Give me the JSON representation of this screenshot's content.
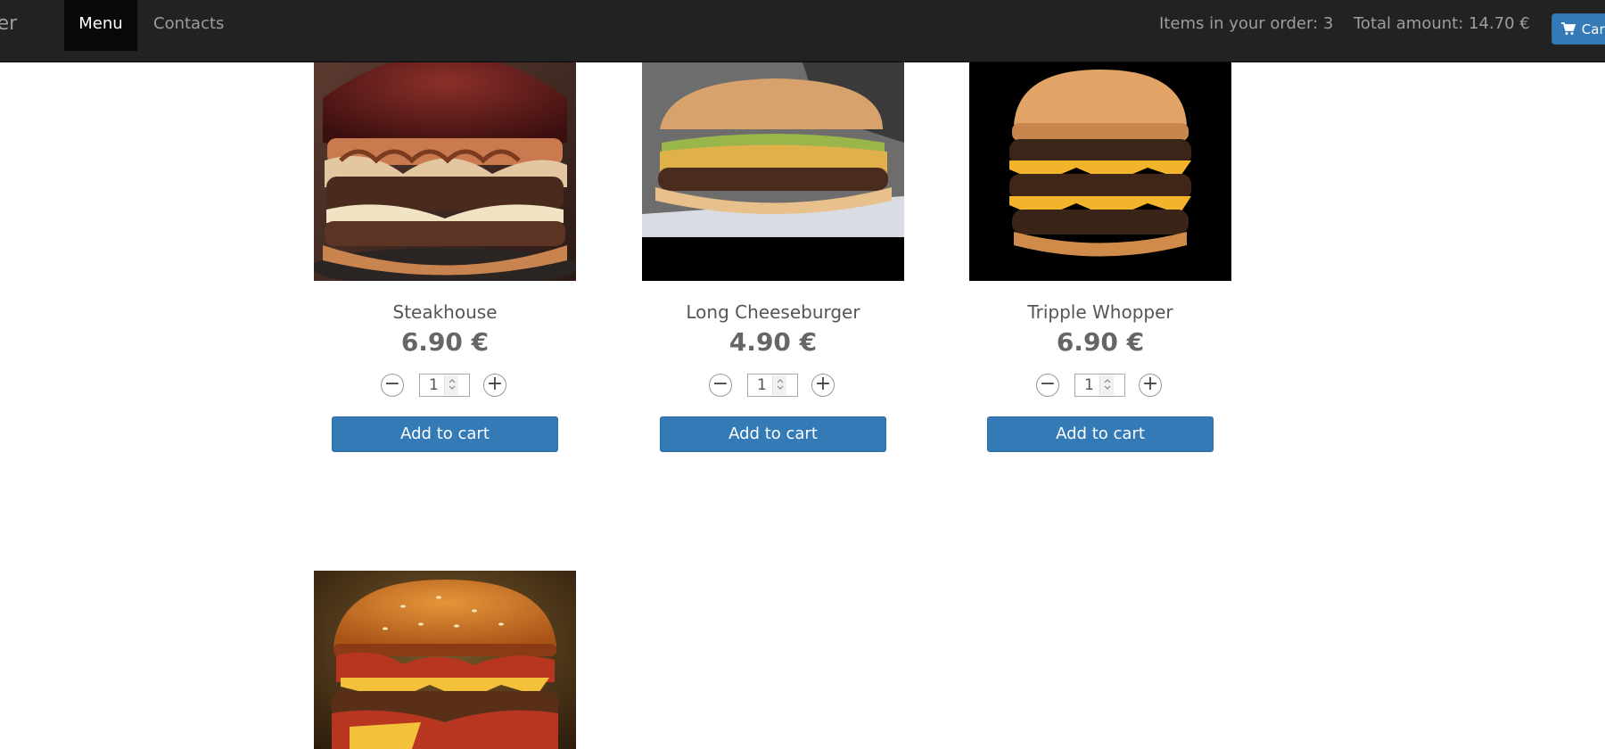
{
  "navbar": {
    "brand": "urger",
    "menu_label": "Menu",
    "contacts_label": "Contacts",
    "items_in_order": "Items in your order: 3",
    "total_amount": "Total amount: 14.70 €",
    "cart_label": "Cart",
    "cart_icon": "shopping-cart-icon"
  },
  "colors": {
    "navbar_bg": "#222222",
    "active_nav_bg": "#080808",
    "primary_button": "#337ab7",
    "price_text": "#666666"
  },
  "products": [
    {
      "name": "Steakhouse",
      "price": "6.90 €",
      "quantity": "1",
      "add_to_cart_label": "Add to cart",
      "image_icon": "steakhouse-burger-image"
    },
    {
      "name": "Long Cheeseburger",
      "price": "4.90 €",
      "quantity": "1",
      "add_to_cart_label": "Add to cart",
      "image_icon": "long-cheeseburger-image"
    },
    {
      "name": "Tripple Whopper",
      "price": "6.90 €",
      "quantity": "1",
      "add_to_cart_label": "Add to cart",
      "image_icon": "tripple-whopper-image"
    },
    {
      "image_icon": "bacon-cheeseburger-image"
    }
  ]
}
